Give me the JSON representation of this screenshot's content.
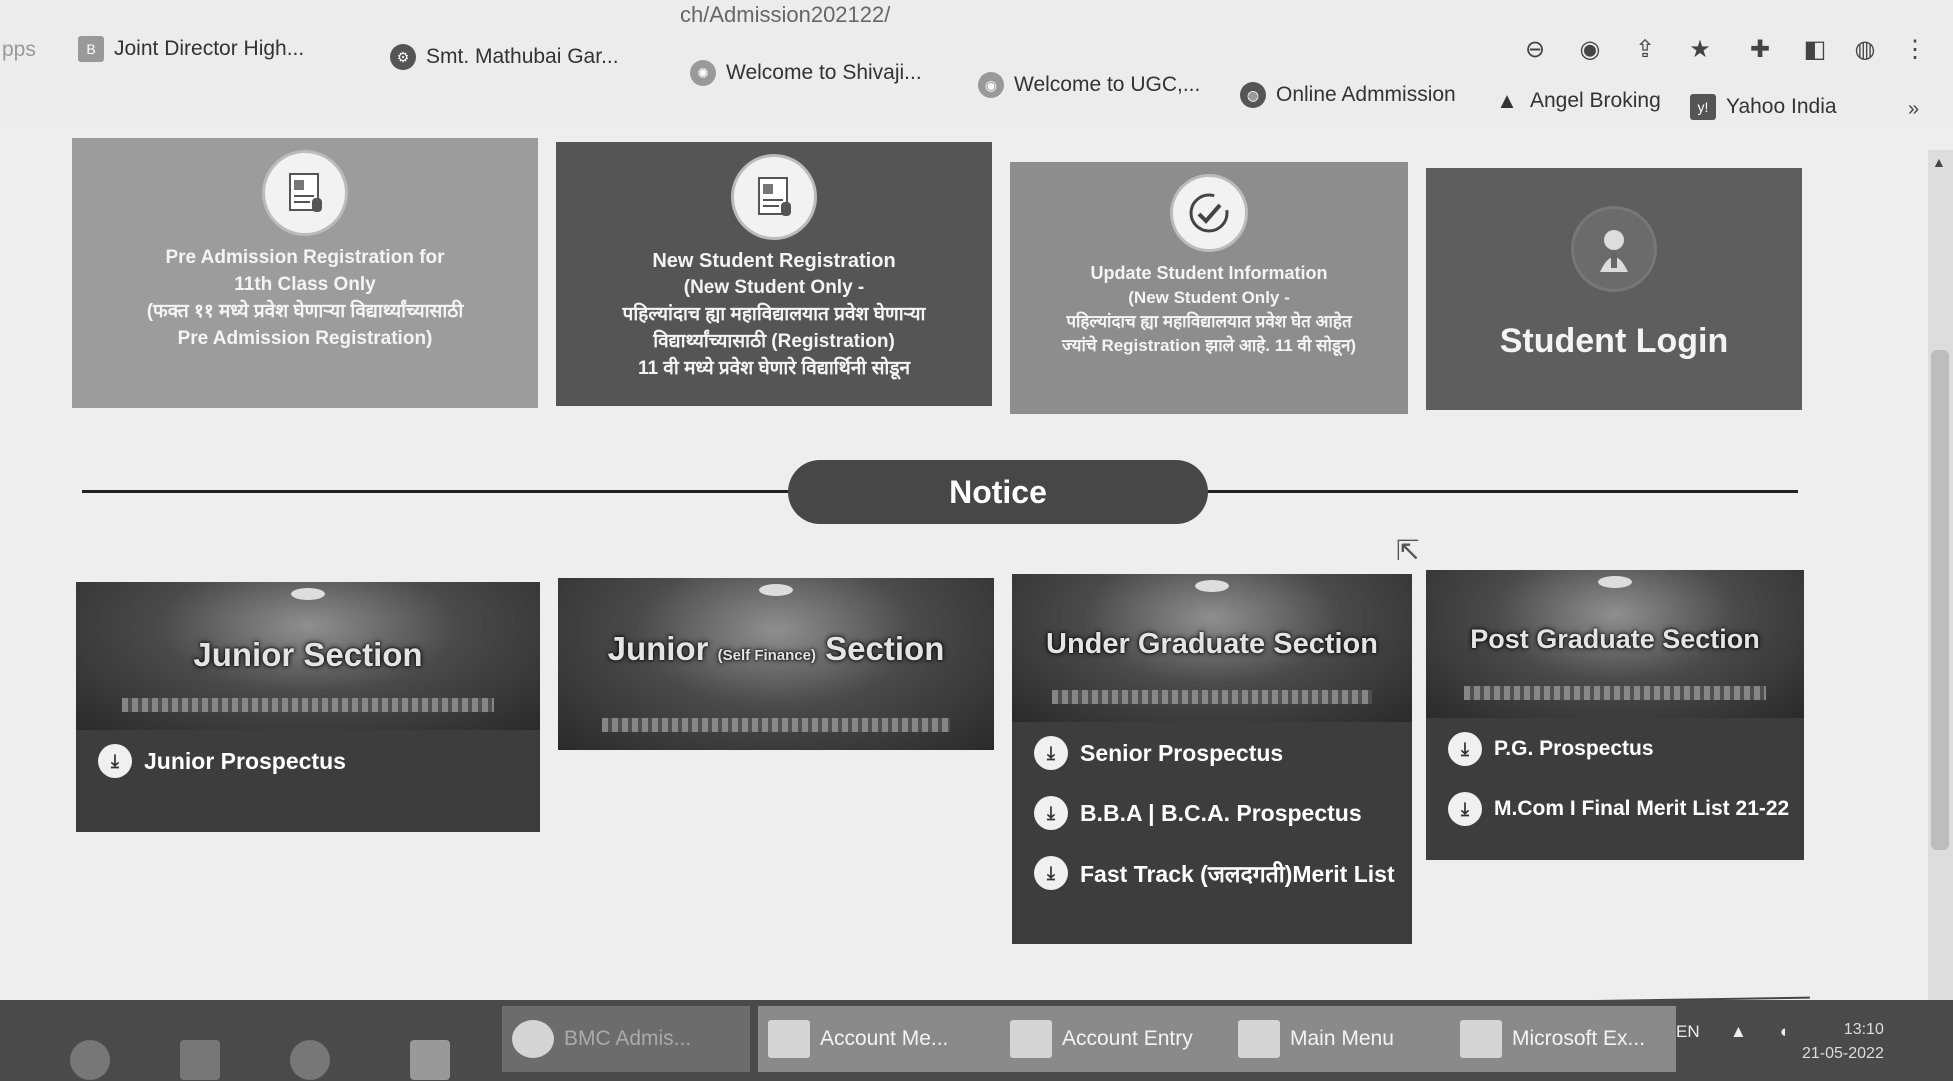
{
  "browser": {
    "url_fragment": "ch/Admission202122/",
    "bookmarks": [
      {
        "label": "Joint Director High...",
        "icon": "blogger-icon"
      },
      {
        "label": "Smt. Mathubai Gar...",
        "icon": "college-logo-icon"
      },
      {
        "label": "Welcome to Shivaji...",
        "icon": "university-logo-icon"
      },
      {
        "label": "Welcome to UGC,...",
        "icon": "ugc-logo-icon"
      },
      {
        "label": "Online Admmission",
        "icon": "globe-icon"
      },
      {
        "label": "Angel Broking",
        "icon": "angel-logo-icon"
      },
      {
        "label": "Yahoo India",
        "icon": "yahoo-icon"
      }
    ],
    "apps_fragment": "pps"
  },
  "top_cards": [
    {
      "lines": [
        "Pre Admission Registration for",
        "11th Class Only",
        "(फक्त ११ मध्ये प्रवेश घेणाऱ्या विद्यार्थ्यांच्यासाठी",
        "Pre Admission Registration)"
      ]
    },
    {
      "title": "New Student Registration",
      "lines": [
        "(New Student Only -",
        "पहिल्यांदाच ह्या महाविद्यालयात प्रवेश घेणाऱ्या",
        "विद्यार्थ्यांच्यासाठी (Registration)",
        "11 वी मध्ये प्रवेश घेणारे विद्यार्थिनी सोडून"
      ]
    },
    {
      "title": "Update Student Information",
      "lines": [
        "(New Student Only -",
        "पहिल्यांदाच ह्या महाविद्यालयात प्रवेश घेत आहेत",
        "ज्यांचे Registration झाले आहे. 11 वी सोडून)"
      ]
    },
    {
      "title": "Student Login"
    }
  ],
  "notice": {
    "label": "Notice"
  },
  "sections": [
    {
      "title": "Junior Section",
      "links": [
        "Junior Prospectus"
      ]
    },
    {
      "title_a": "Junior",
      "title_small": "(Self Finance)",
      "title_b": "Section",
      "links": []
    },
    {
      "title": "Under Graduate Section",
      "links": [
        "Senior Prospectus",
        "B.B.A | B.C.A. Prospectus",
        "Fast Track (जलदगती)Merit List"
      ]
    },
    {
      "title": "Post Graduate Section",
      "links": [
        "P.G. Prospectus",
        "M.Com I Final Merit List 21-22"
      ]
    }
  ],
  "taskbar": {
    "items": [
      "BMC Admis...",
      "Account Me...",
      "Account Entry",
      "Main Menu",
      "Microsoft Ex..."
    ],
    "lang": "EN",
    "time": "13:10",
    "date": "21-05-2022"
  }
}
